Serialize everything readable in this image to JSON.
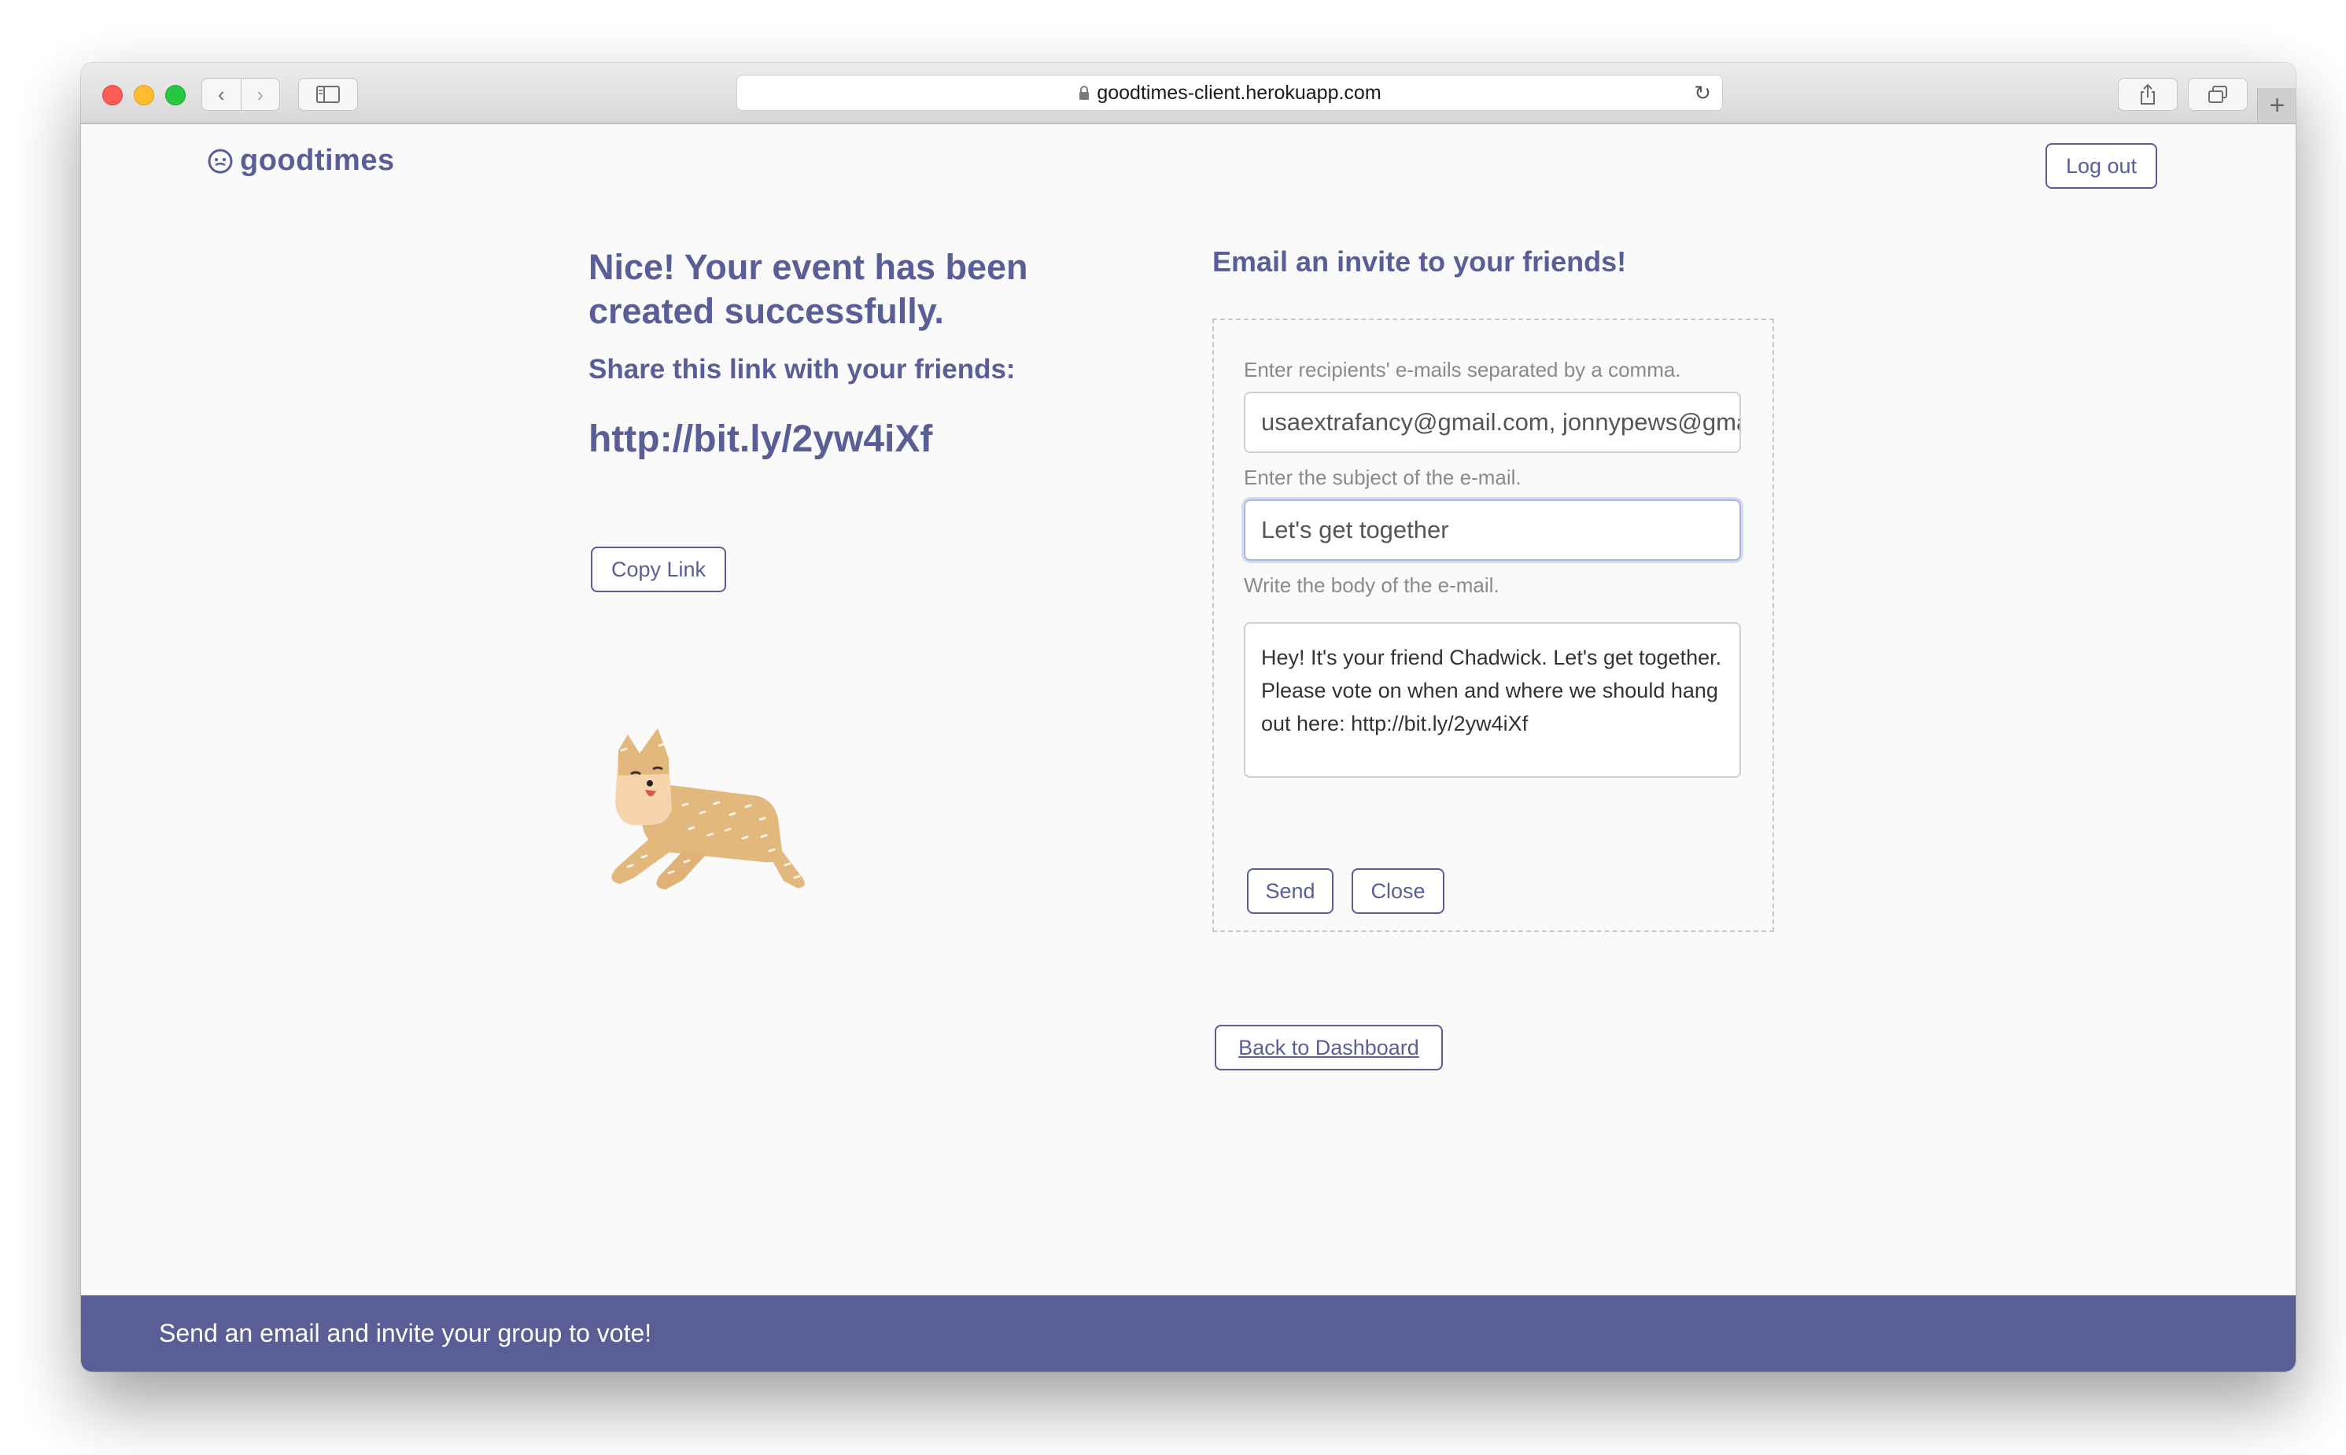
{
  "browser": {
    "address": "goodtimes-client.herokuapp.com",
    "icons": {
      "back": "chevron-left-icon",
      "forward": "chevron-right-icon",
      "sidebar": "sidebar-icon",
      "lock": "lock-icon",
      "reload": "reload-icon",
      "share": "share-icon",
      "tabs": "tabs-icon",
      "new_tab": "plus-icon"
    }
  },
  "header": {
    "brand": "goodtimes",
    "brand_icon": "smiley-icon",
    "logout_label": "Log out"
  },
  "success": {
    "headline": "Nice! Your event has been created successfully.",
    "share_label": "Share this link with your friends:",
    "share_url": "http://bit.ly/2yw4iXf",
    "copy_label": "Copy Link",
    "illustration": "dog-illustration"
  },
  "invite": {
    "title": "Email an invite to your friends!",
    "recipients_label": "Enter recipients' e-mails separated by a comma.",
    "recipients_value": "usaextrafancy@gmail.com, jonnypews@gmail.com",
    "subject_label": "Enter the subject of the e-mail.",
    "subject_value": "Let's get together",
    "body_label": "Write the body of the e-mail.",
    "body_value": "Hey! It's your friend Chadwick. Let's get together. Please vote on when and where we should hang out here: http://bit.ly/2yw4iXf",
    "send_label": "Send",
    "close_label": "Close"
  },
  "back_label": "Back to Dashboard",
  "footer": {
    "text": "Send an email and invite your group to vote!"
  },
  "colors": {
    "accent": "#595e97",
    "background": "#fafafa"
  }
}
